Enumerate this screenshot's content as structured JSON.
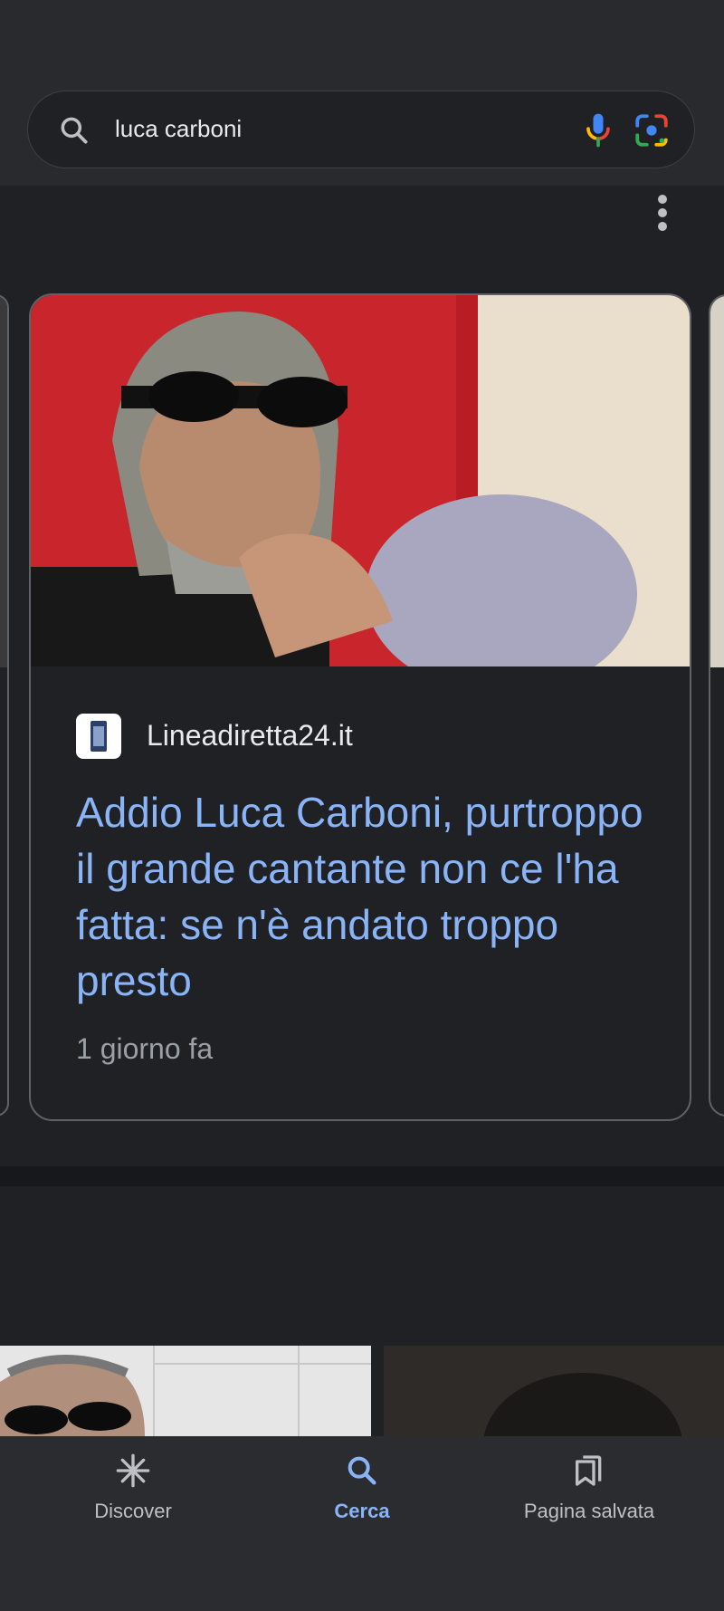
{
  "search": {
    "query": "luca carboni"
  },
  "icons": {
    "search": "search-icon",
    "mic": "microphone-icon",
    "lens": "google-lens-icon",
    "more": "more-vert-icon"
  },
  "article": {
    "source": "Lineadiretta24.it",
    "headline": "Addio Luca Carboni, purtroppo il grande cantante non ce l'ha fatta: se n'è andato troppo presto",
    "time": "1 giorno fa"
  },
  "bottom_nav": {
    "items": [
      {
        "label": "Discover",
        "icon": "discover-asterisk-icon",
        "active": false
      },
      {
        "label": "Cerca",
        "icon": "search-icon",
        "active": true
      },
      {
        "label": "Pagina salvata",
        "icon": "saved-pages-icon",
        "active": false
      }
    ]
  },
  "colors": {
    "background": "#202124",
    "link": "#8ab4f8",
    "secondary_text": "#9aa0a6",
    "card_border": "#5f6368"
  }
}
